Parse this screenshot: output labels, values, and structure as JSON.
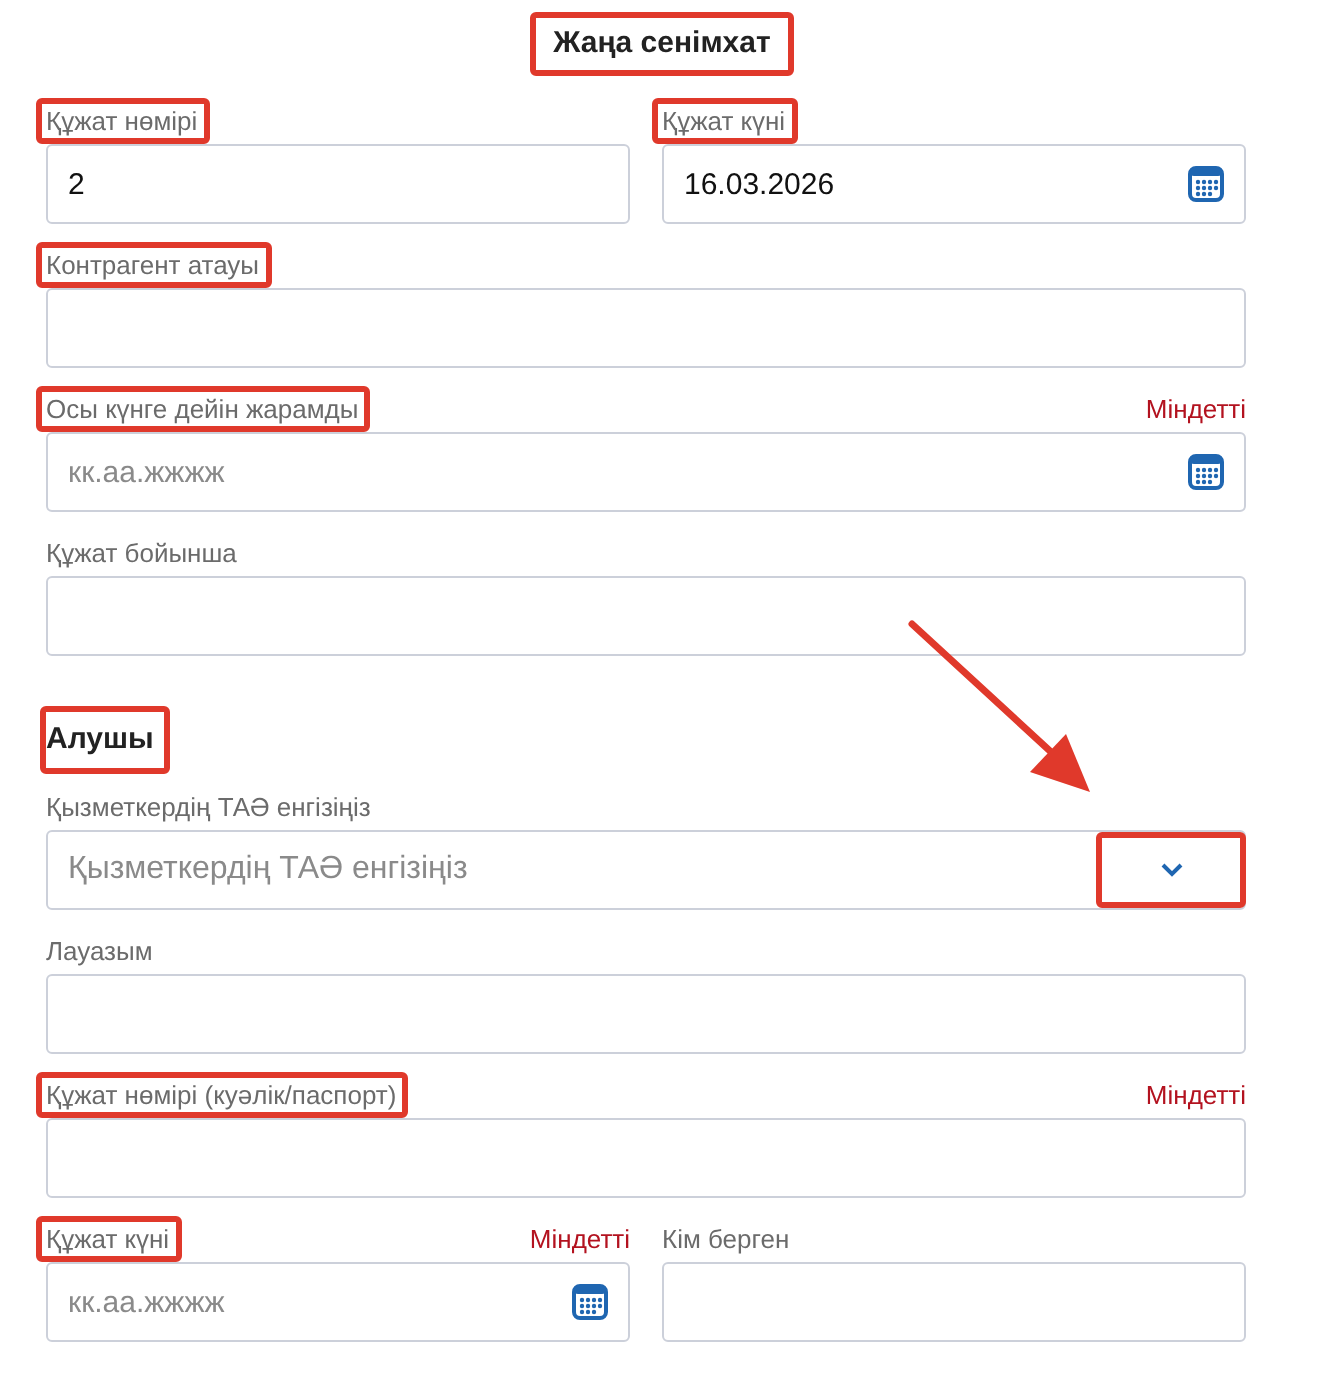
{
  "title": {
    "text": "Жаңа сенімхат",
    "highlighted": true
  },
  "sections": [
    {
      "rows": [
        [
          {
            "kind": "text",
            "label": "Құжат нөмірі",
            "highlighted": true,
            "value": "2"
          },
          {
            "kind": "date",
            "label": "Құжат күні",
            "highlighted": true,
            "value": "16.03.2026"
          }
        ],
        [
          {
            "kind": "text",
            "label": "Контрагент атауы",
            "highlighted": true
          }
        ],
        [
          {
            "kind": "date",
            "label": "Осы күнге дейін жарамды",
            "highlighted": true,
            "required": "Міндетті",
            "placeholder": "кк.аа.жжжж"
          }
        ],
        [
          {
            "kind": "text",
            "label": "Құжат бойынша",
            "highlighted": false
          }
        ]
      ]
    },
    {
      "heading": {
        "text": "Алушы",
        "highlighted": true
      },
      "rows": [
        [
          {
            "kind": "select",
            "label": "Қызметкердің ТАӘ енгізіңіз",
            "highlighted": false,
            "placeholder": "Қызметкердің ТАӘ енгізіңіз",
            "toggle_highlighted": true
          }
        ],
        [
          {
            "kind": "text",
            "label": "Лауазым",
            "highlighted": false
          }
        ],
        [
          {
            "kind": "text",
            "label": "Құжат нөмірі (куәлік/паспорт)",
            "highlighted": true,
            "required": "Міндетті"
          }
        ],
        [
          {
            "kind": "date",
            "label": "Құжат күні",
            "highlighted": true,
            "required": "Міндетті",
            "placeholder": "кк.аа.жжжж"
          },
          {
            "kind": "text",
            "label": "Кім берген",
            "highlighted": false
          }
        ]
      ]
    }
  ]
}
